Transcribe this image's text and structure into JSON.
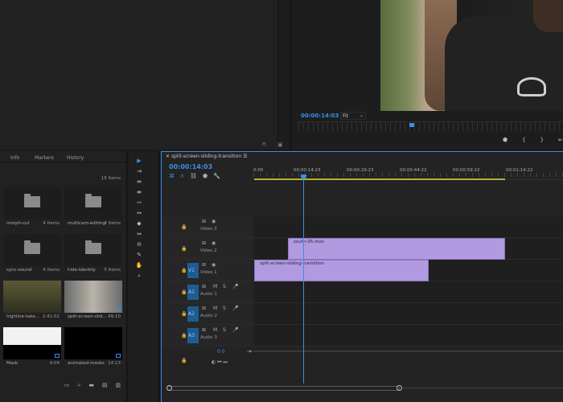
{
  "program": {
    "timecode": "00:00:14:03",
    "zoom": "Fit"
  },
  "project": {
    "tabs": [
      "Info",
      "Markers",
      "History"
    ],
    "item_count": "16 Items",
    "bins": [
      {
        "name": "morph-cut",
        "meta": "4 Items",
        "kind": "folder"
      },
      {
        "name": "multicam-editing",
        "meta": "4 Items",
        "kind": "folder"
      },
      {
        "name": "sync-sound",
        "meta": "4 Items",
        "kind": "folder"
      },
      {
        "name": "hide-identity",
        "meta": "5 Items",
        "kind": "folder"
      },
      {
        "name": "highline-take…",
        "meta": "2:41:02",
        "kind": "video"
      },
      {
        "name": "split-screen-slid…",
        "meta": "49:10",
        "kind": "sequence"
      },
      {
        "name": "Mask",
        "meta": "4:04",
        "kind": "matte"
      },
      {
        "name": "animated-masks",
        "meta": "14:13",
        "kind": "black"
      }
    ]
  },
  "timeline": {
    "sequence_name": "split-screen-sliding-transition",
    "timecode": "00:00:14:03",
    "ruler": [
      "0:00",
      "00:00:14:23",
      "00:00:29:23",
      "00:00:44:22",
      "00:00:59:22",
      "00:01:14:22"
    ],
    "tracks": [
      {
        "id": "V3",
        "name": "Video 3",
        "source": ""
      },
      {
        "id": "V2",
        "name": "Video 2",
        "source": ""
      },
      {
        "id": "V1",
        "name": "Video 1",
        "source": "V1"
      },
      {
        "id": "A1",
        "name": "Audio 1",
        "source": "A1"
      },
      {
        "id": "A2",
        "name": "Audio 2",
        "source": "A2"
      },
      {
        "id": "A3",
        "name": "Audio 3",
        "source": "A3"
      }
    ],
    "clips": {
      "v2": "south-05.mov",
      "v1": "split-screen-sliding-transition"
    },
    "master_value": "0.0"
  },
  "colors": {
    "accent": "#3b8ee8",
    "clip": "#b19ae0",
    "work_area": "#b8b234"
  }
}
